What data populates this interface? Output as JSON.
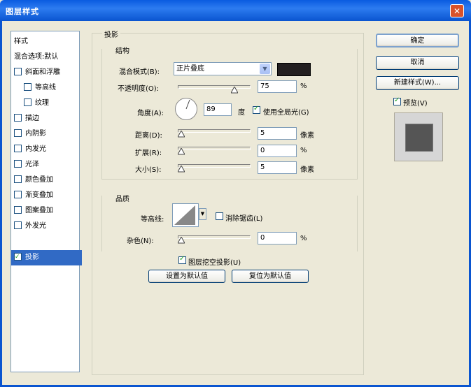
{
  "window": {
    "title": "图层样式",
    "close_glyph": "✕"
  },
  "sidebar": {
    "items": [
      {
        "label": "样式",
        "checkbox": false,
        "checked": false,
        "selected": false
      },
      {
        "label": "混合选项:默认",
        "checkbox": false,
        "checked": false,
        "selected": false
      },
      {
        "label": "斜面和浮雕",
        "checkbox": true,
        "checked": false,
        "selected": false
      },
      {
        "label": "等高线",
        "checkbox": true,
        "checked": false,
        "selected": false,
        "indent": true
      },
      {
        "label": "纹理",
        "checkbox": true,
        "checked": false,
        "selected": false,
        "indent": true
      },
      {
        "label": "描边",
        "checkbox": true,
        "checked": false,
        "selected": false
      },
      {
        "label": "内阴影",
        "checkbox": true,
        "checked": false,
        "selected": false
      },
      {
        "label": "内发光",
        "checkbox": true,
        "checked": false,
        "selected": false
      },
      {
        "label": "光泽",
        "checkbox": true,
        "checked": false,
        "selected": false
      },
      {
        "label": "颜色叠加",
        "checkbox": true,
        "checked": false,
        "selected": false
      },
      {
        "label": "渐变叠加",
        "checkbox": true,
        "checked": false,
        "selected": false
      },
      {
        "label": "图案叠加",
        "checkbox": true,
        "checked": false,
        "selected": false
      },
      {
        "label": "外发光",
        "checkbox": true,
        "checked": false,
        "selected": false
      },
      {
        "label": "投影",
        "checkbox": true,
        "checked": true,
        "selected": true
      }
    ]
  },
  "panel": {
    "title": "投影",
    "structure": {
      "title": "结构",
      "blend_mode_label": "混合模式(B):",
      "blend_mode_value": "正片叠底",
      "blend_color": "#231F20",
      "opacity_label": "不透明度(O):",
      "opacity_value": "75",
      "opacity_unit": "%",
      "angle_label": "角度(A):",
      "angle_value": "89",
      "angle_unit": "度",
      "global_light_label": "使用全局光(G)",
      "global_light_checked": true,
      "distance_label": "距离(D):",
      "distance_value": "5",
      "distance_unit": "像素",
      "spread_label": "扩展(R):",
      "spread_value": "0",
      "spread_unit": "%",
      "size_label": "大小(S):",
      "size_value": "5",
      "size_unit": "像素"
    },
    "quality": {
      "title": "品质",
      "contour_label": "等高线:",
      "anti_alias_label": "消除锯齿(L)",
      "anti_alias_checked": false,
      "noise_label": "杂色(N):",
      "noise_value": "0",
      "noise_unit": "%"
    },
    "knockout_label": "图层挖空投影(U)",
    "knockout_checked": true,
    "make_default_label": "设置为默认值",
    "reset_default_label": "复位为默认值"
  },
  "buttons": {
    "ok": "确定",
    "cancel": "取消",
    "new_style": "新建样式(W)...",
    "preview_label": "预览(V)",
    "preview_checked": true
  }
}
